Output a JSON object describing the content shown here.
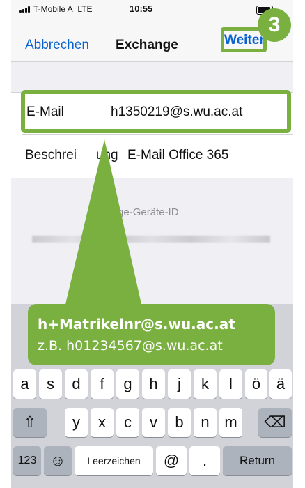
{
  "status_bar": {
    "carrier": "T-Mobile A",
    "network": "LTE",
    "time": "10:55"
  },
  "nav": {
    "cancel": "Abbrechen",
    "title": "Exchange",
    "next": "Weiter"
  },
  "step_badge": "3",
  "form": {
    "email": {
      "label": "E-Mail",
      "value": "h1350219@s.wu.ac.at"
    },
    "description": {
      "label": "Beschrei",
      "label_tail": "ung",
      "value": "E-Mail Office 365"
    }
  },
  "device_section": {
    "label": "hange-Geräte-ID"
  },
  "callout": {
    "title": "h+Matrikelnr@s.wu.ac.at",
    "example": "z.B. h01234567@s.wu.ac.at"
  },
  "keyboard": {
    "row2": [
      "a",
      "s",
      "d",
      "f",
      "g",
      "h",
      "j",
      "k",
      "l",
      "ö",
      "ä"
    ],
    "row3": [
      "y",
      "x",
      "c",
      "v",
      "b",
      "n",
      "m"
    ],
    "shift_icon": "⇧",
    "delete_icon": "⌫",
    "numbers": "123",
    "emoji_icon": "☺",
    "space": "Leerzeichen",
    "at": "@",
    "dot": ".",
    "return": "Return"
  },
  "colors": {
    "accent_green": "#7ab040",
    "ios_blue": "#0b63ce"
  }
}
